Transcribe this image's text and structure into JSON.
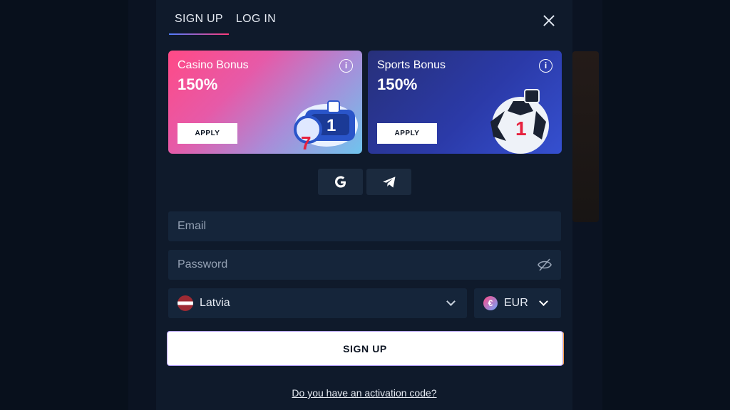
{
  "tabs": [
    {
      "label": "SIGN UP",
      "active": true
    },
    {
      "label": "LOG IN",
      "active": false
    }
  ],
  "bonuses": [
    {
      "title": "Casino Bonus",
      "value": "150%",
      "button": "APPLY",
      "icon": "info-icon"
    },
    {
      "title": "Sports Bonus",
      "value": "150%",
      "button": "APPLY",
      "icon": "info-icon"
    }
  ],
  "social": [
    {
      "icon": "google-icon"
    },
    {
      "icon": "telegram-icon"
    }
  ],
  "form": {
    "email_placeholder": "Email",
    "password_placeholder": "Password",
    "country": "Latvia",
    "currency": "EUR",
    "currency_symbol": "€",
    "submit": "SIGN UP",
    "activation_link": "Do you have an activation code?"
  },
  "colors": {
    "modal_bg": "#0f1a2b",
    "field_bg": "#15253a",
    "accent_pink": "#ff4a86",
    "accent_blue": "#4f7dff"
  }
}
